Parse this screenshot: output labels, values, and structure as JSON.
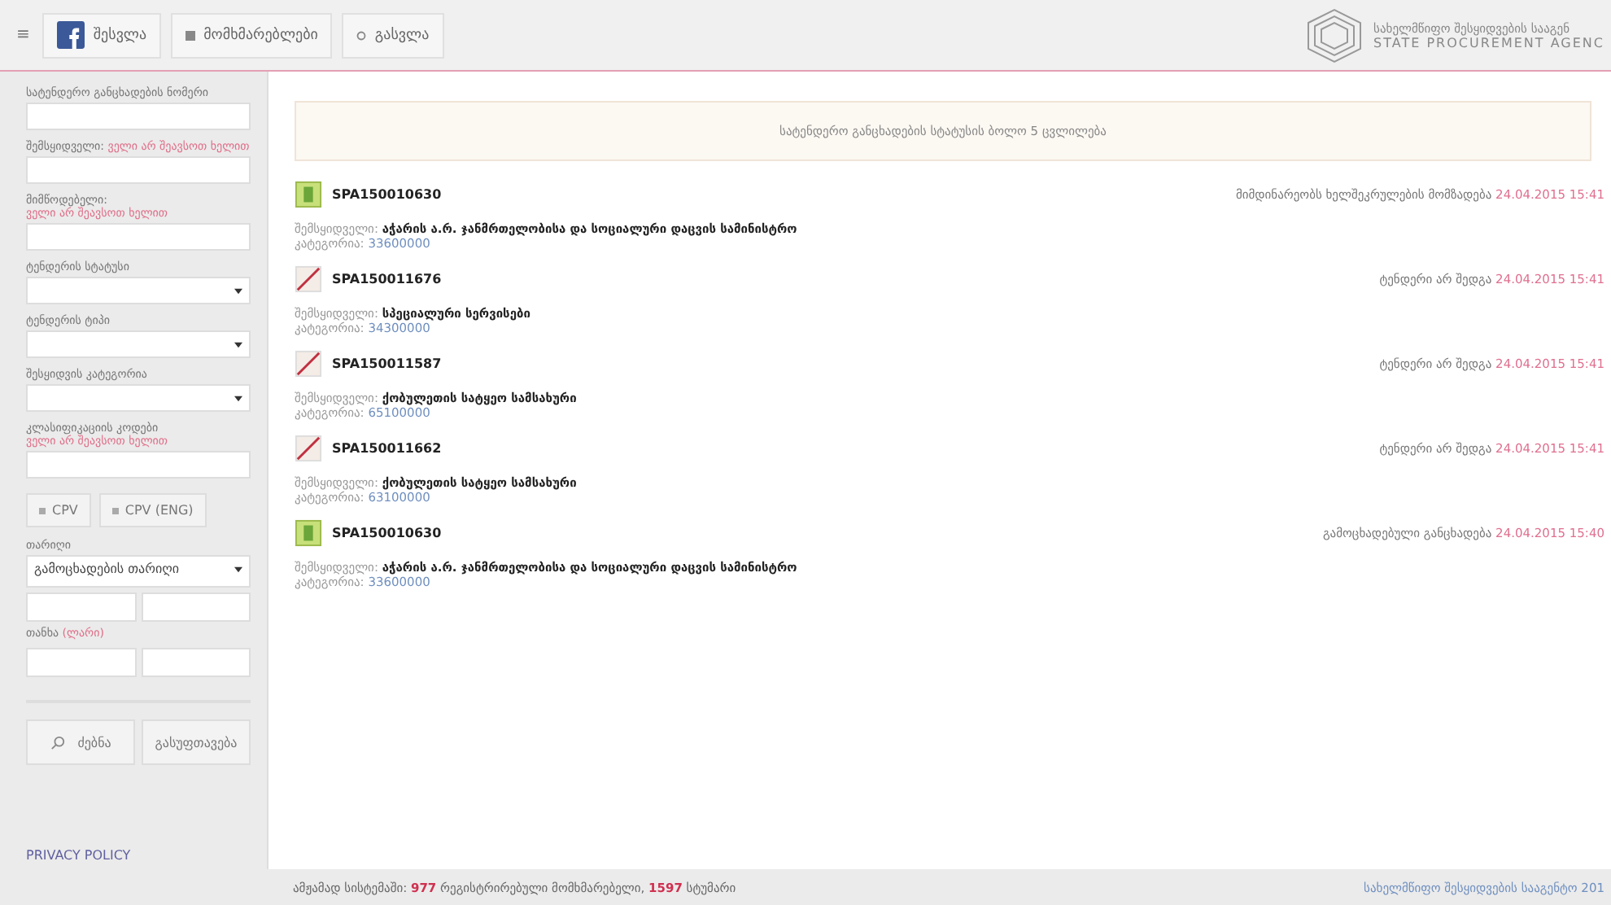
{
  "top_menu": {
    "menu_icon": "≡",
    "items": [
      {
        "kind": "facebook",
        "label": "შესვლა"
      },
      {
        "kind": "square",
        "label": "მომხმარებლები"
      },
      {
        "kind": "circle",
        "label": "გასვლა"
      }
    ]
  },
  "logo": {
    "title": "სახელმწიფო შესყიდვების სააგენ",
    "subtitle": "STATE PROCUREMENT AGENC"
  },
  "filters": [
    {
      "kind": "text",
      "label": "სატენდერო განცხადების ნომერი"
    },
    {
      "kind": "text",
      "label": "შემსყიდველი:",
      "hint": "ველი არ შეავსოთ ხელით"
    },
    {
      "kind": "text",
      "label": "მიმწოდებელი:",
      "hint": "ველი არ შეავსოთ ხელით"
    },
    {
      "kind": "select",
      "label": "ტენდერის სტატუსი"
    },
    {
      "kind": "select",
      "label": "ტენდერის ტიპი"
    },
    {
      "kind": "select",
      "label": "შესყიდვის კატეგორია"
    },
    {
      "kind": "text",
      "label": "კლასიფიკაციის კოდები",
      "hint": "ველი არ შეავსოთ ხელით"
    }
  ],
  "cpv_buttons": [
    "CPV",
    "CPV (ENG)"
  ],
  "date": {
    "label": "თარიღი",
    "value": "გამოცხადების თარიღი"
  },
  "amount": {
    "label": "თანხა",
    "hint": "(ლარი)"
  },
  "actions": [
    {
      "kind": "search",
      "label": "ძებნა"
    },
    {
      "kind": "plain",
      "label": "გასუფთავება"
    }
  ],
  "privacy": "PRIVACY POLICY",
  "notice": "სატენდერო განცხადების სტატუსის ბოლო 5 ცვლილება",
  "entries": [
    {
      "kind": "active",
      "number": "SPA150010630",
      "buyer_label": "შემსყიდველი:",
      "buyer": "აჭარის ა.რ. ჯანმრთელობისა და სოციალური დაცვის სამინისტრო",
      "category_label": "კატეგორია:",
      "category": "33600000",
      "state": "მიმდინარეობს ხელშეკრულების მომზადება",
      "time": "24.04.2015 15:41"
    },
    {
      "kind": "failed",
      "number": "SPA150011676",
      "buyer_label": "შემსყიდველი:",
      "buyer": "სპეციალური სერვისები",
      "category_label": "კატეგორია:",
      "category": "34300000",
      "state": "ტენდერი არ შედგა",
      "time": "24.04.2015 15:41"
    },
    {
      "kind": "failed",
      "number": "SPA150011587",
      "buyer_label": "შემსყიდველი:",
      "buyer": "ქობულეთის სატყეო სამსახური",
      "category_label": "კატეგორია:",
      "category": "65100000",
      "state": "ტენდერი არ შედგა",
      "time": "24.04.2015 15:41"
    },
    {
      "kind": "failed",
      "number": "SPA150011662",
      "buyer_label": "შემსყიდველი:",
      "buyer": "ქობულეთის სატყეო სამსახური",
      "category_label": "კატეგორია:",
      "category": "63100000",
      "state": "ტენდერი არ შედგა",
      "time": "24.04.2015 15:41"
    },
    {
      "kind": "active",
      "number": "SPA150010630",
      "buyer_label": "შემსყიდველი:",
      "buyer": "აჭარის ა.რ. ჯანმრთელობისა და სოციალური დაცვის სამინისტრო",
      "category_label": "კატეგორია:",
      "category": "33600000",
      "state": "გამოცხადებული განცხადება",
      "time": "24.04.2015 15:40"
    }
  ],
  "status_bar": {
    "online": "ამჟამად სისტემაში: **977** რეგისტრირებული მომხმარებელი, **1597** სტუმარი",
    "copyright": "სახელმწიფო შესყიდვების სააგენტო 201"
  }
}
